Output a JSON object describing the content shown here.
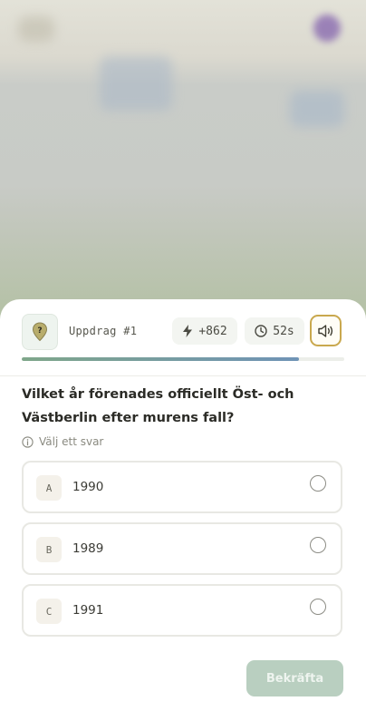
{
  "mission": {
    "label": "Uppdrag #1",
    "icon": "map-pin-question-icon"
  },
  "stats": {
    "points": "+862",
    "points_icon": "bolt-icon",
    "time": "52s",
    "time_icon": "clock-icon"
  },
  "sound": {
    "icon": "speaker-icon"
  },
  "progress": {
    "fraction": 0.86
  },
  "question": {
    "text": "Vilket år förenades officiellt Öst- och Västberlin efter murens fall?"
  },
  "hint": {
    "text": "Välj ett svar",
    "icon": "info-icon"
  },
  "options": [
    {
      "letter": "A",
      "text": "1990"
    },
    {
      "letter": "B",
      "text": "1989"
    },
    {
      "letter": "C",
      "text": "1991"
    }
  ],
  "confirm": {
    "label": "Bekräfta"
  },
  "colors": {
    "accent_border": "#c9a84e",
    "progress_start": "#7fa68a",
    "progress_end": "#6f93b6",
    "confirm_bg": "#b9cfc0"
  }
}
